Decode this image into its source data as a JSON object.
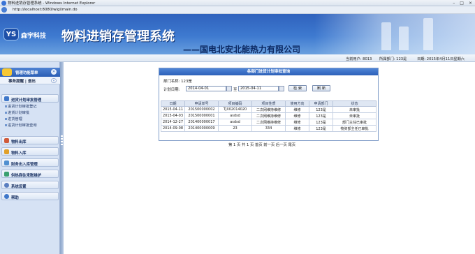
{
  "window": {
    "title": "物料进销存管理系统 - Windows Internet Explorer",
    "url": "http://localhost:8080/wlgl/main.do"
  },
  "banner": {
    "logo_mark": "YS",
    "logo_text": "森宇科技",
    "system_title": "物料进销存管理系统",
    "company": "——国电北安北能热力有限公司"
  },
  "infobar": {
    "user": "当前用户: 8013",
    "dept": "所属部门: 123是",
    "date": "日期: 2015年4月11日星期六"
  },
  "sidebar": {
    "header": "管理功能菜单",
    "sub": "事务提醒 | 退出",
    "sub_toggle": "«",
    "head_toggle": "»",
    "sections": [
      {
        "label": "进货计划审批管理",
        "items": [
          "进货计划审批登记",
          "进货计划审批",
          "进货管理",
          "进货计划审批查询"
        ]
      },
      {
        "label": "物料出库"
      },
      {
        "label": "物料入库"
      },
      {
        "label": "财务出入库管理"
      },
      {
        "label": "供热商往来账维护"
      },
      {
        "label": "系统设置"
      },
      {
        "label": "帮助"
      }
    ]
  },
  "panel": {
    "title": "各部门进货计划审批查询",
    "dept_label": "部门名称:",
    "dept_value": "123是",
    "date_label": "计划日期:",
    "date_from": "2014-04-01",
    "date_to_sep": "至",
    "date_to": "2015-04-11",
    "search_btn": "检  索",
    "refresh_btn": "刷  新",
    "columns": [
      "日期",
      "申请单号",
      "项目编码",
      "项目性质",
      "使用方向",
      "申请部门",
      "状态"
    ],
    "rows": [
      [
        "2015-04-11",
        "201500000002",
        "TJX02014020",
        "二次网维持维修",
        "维修",
        "123是",
        "未审批"
      ],
      [
        "2015-04-03",
        "201500000001",
        "asdsd",
        "二次网维持维修",
        "维修",
        "123是",
        "未审批"
      ],
      [
        "2014-12-27",
        "201400000017",
        "asdsd",
        "二次网维持维修",
        "维修",
        "123是",
        "部门主任已审批"
      ],
      [
        "2014-09-08",
        "201400000009",
        "23",
        "334",
        "维修",
        "123是",
        "物资部主任已审批"
      ]
    ],
    "pager": "第 1 页 共 1 页 首页 前一页 后一页 尾页"
  }
}
